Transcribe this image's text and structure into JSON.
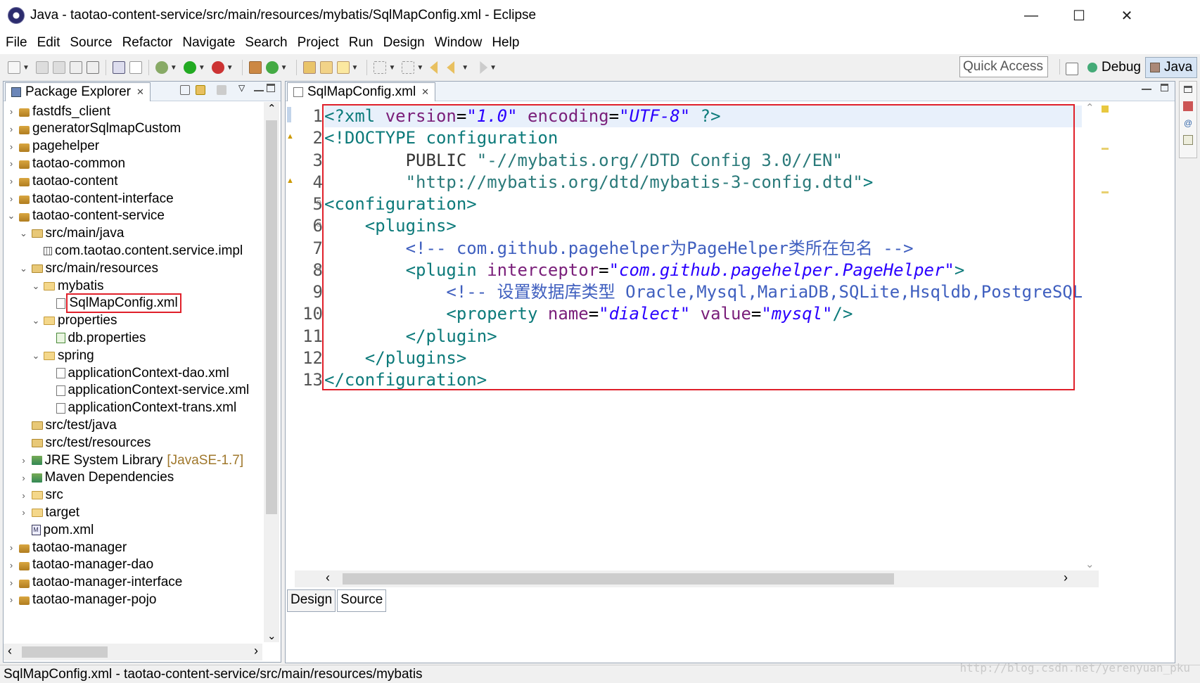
{
  "window": {
    "title": "Java - taotao-content-service/src/main/resources/mybatis/SqlMapConfig.xml - Eclipse",
    "minimize": "—",
    "maximize": "☐",
    "close": "✕"
  },
  "menu": [
    "File",
    "Edit",
    "Source",
    "Refactor",
    "Navigate",
    "Search",
    "Project",
    "Run",
    "Design",
    "Window",
    "Help"
  ],
  "toolbar": {
    "quick_access": "Quick Access",
    "perspective_debug": "Debug",
    "perspective_java": "Java"
  },
  "package_explorer": {
    "title": "Package Explorer",
    "items": [
      {
        "label": "fastdfs_client",
        "arrow": "›",
        "icon": "project-icon"
      },
      {
        "label": "generatorSqlmapCustom",
        "arrow": "›",
        "icon": "project-icon"
      },
      {
        "label": "pagehelper",
        "arrow": "›",
        "icon": "project-icon"
      },
      {
        "label": "taotao-common",
        "arrow": "›",
        "icon": "project-icon"
      },
      {
        "label": "taotao-content",
        "arrow": "›",
        "icon": "project-icon"
      },
      {
        "label": "taotao-content-interface",
        "arrow": "›",
        "icon": "project-icon"
      },
      {
        "label": "taotao-content-service",
        "arrow": "⌄",
        "icon": "project-icon"
      },
      {
        "label": "src/main/java",
        "arrow": "⌄",
        "icon": "source-folder-icon"
      },
      {
        "label": "com.taotao.content.service.impl",
        "arrow": "",
        "icon": "package-icon"
      },
      {
        "label": "src/main/resources",
        "arrow": "⌄",
        "icon": "source-folder-icon"
      },
      {
        "label": "mybatis",
        "arrow": "⌄",
        "icon": "folder-icon"
      },
      {
        "label": "SqlMapConfig.xml",
        "arrow": "",
        "icon": "xml-file-icon"
      },
      {
        "label": "properties",
        "arrow": "⌄",
        "icon": "folder-icon"
      },
      {
        "label": "db.properties",
        "arrow": "",
        "icon": "properties-file-icon"
      },
      {
        "label": "spring",
        "arrow": "⌄",
        "icon": "folder-icon"
      },
      {
        "label": "applicationContext-dao.xml",
        "arrow": "",
        "icon": "xml-file-icon"
      },
      {
        "label": "applicationContext-service.xml",
        "arrow": "",
        "icon": "xml-file-icon"
      },
      {
        "label": "applicationContext-trans.xml",
        "arrow": "",
        "icon": "xml-file-icon"
      },
      {
        "label": "src/test/java",
        "arrow": "",
        "icon": "source-folder-icon"
      },
      {
        "label": "src/test/resources",
        "arrow": "",
        "icon": "source-folder-icon"
      },
      {
        "label": "JRE System Library",
        "suffix": "[JavaSE-1.7]",
        "arrow": "›",
        "icon": "library-icon"
      },
      {
        "label": "Maven Dependencies",
        "arrow": "›",
        "icon": "library-icon"
      },
      {
        "label": "src",
        "arrow": "›",
        "icon": "folder-icon"
      },
      {
        "label": "target",
        "arrow": "›",
        "icon": "folder-icon"
      },
      {
        "label": "pom.xml",
        "arrow": "",
        "icon": "maven-file-icon"
      },
      {
        "label": "taotao-manager",
        "arrow": "›",
        "icon": "project-icon"
      },
      {
        "label": "taotao-manager-dao",
        "arrow": "›",
        "icon": "project-icon"
      },
      {
        "label": "taotao-manager-interface",
        "arrow": "›",
        "icon": "project-icon"
      },
      {
        "label": "taotao-manager-pojo",
        "arrow": "›",
        "icon": "project-icon"
      }
    ]
  },
  "editor": {
    "tab_title": "SqlMapConfig.xml",
    "line_numbers": [
      "1",
      "2",
      "3",
      "4",
      "5",
      "6",
      "7",
      "8",
      "9",
      "10",
      "11",
      "12",
      "13"
    ],
    "lines": [
      [
        {
          "t": "<?xml ",
          "c": "pi"
        },
        {
          "t": "version",
          "c": "attr"
        },
        {
          "t": "=",
          "c": "plain"
        },
        {
          "t": "\"1.0\"",
          "c": "str"
        },
        {
          "t": " ",
          "c": "plain"
        },
        {
          "t": "encoding",
          "c": "attr"
        },
        {
          "t": "=",
          "c": "plain"
        },
        {
          "t": "\"UTF-8\"",
          "c": "str"
        },
        {
          "t": " ?>",
          "c": "pi"
        }
      ],
      [
        {
          "t": "<!DOCTYPE configuration",
          "c": "kw"
        }
      ],
      [
        {
          "t": "        PUBLIC ",
          "c": "doc"
        },
        {
          "t": "\"-//mybatis.org//DTD Config 3.0//EN\"",
          "c": "dstr"
        }
      ],
      [
        {
          "t": "        ",
          "c": "doc"
        },
        {
          "t": "\"http://mybatis.org/dtd/mybatis-3-config.dtd\"",
          "c": "dstr"
        },
        {
          "t": ">",
          "c": "kw"
        }
      ],
      [
        {
          "t": "<configuration>",
          "c": "tag"
        }
      ],
      [
        {
          "t": "    <plugins>",
          "c": "tag"
        }
      ],
      [
        {
          "t": "        <!-- com.github.pagehelper为PageHelper类所在包名 -->",
          "c": "comment"
        }
      ],
      [
        {
          "t": "        <plugin ",
          "c": "tag"
        },
        {
          "t": "interceptor",
          "c": "attr"
        },
        {
          "t": "=",
          "c": "plain"
        },
        {
          "t": "\"com.github.pagehelper.PageHelper\"",
          "c": "str"
        },
        {
          "t": ">",
          "c": "tag"
        }
      ],
      [
        {
          "t": "            <!-- 设置数据库类型 Oracle,Mysql,MariaDB,SQLite,Hsqldb,PostgreSQL六种数据库-->",
          "c": "comment"
        }
      ],
      [
        {
          "t": "            <property ",
          "c": "tag"
        },
        {
          "t": "name",
          "c": "attr"
        },
        {
          "t": "=",
          "c": "plain"
        },
        {
          "t": "\"dialect\"",
          "c": "str"
        },
        {
          "t": " ",
          "c": "plain"
        },
        {
          "t": "value",
          "c": "attr"
        },
        {
          "t": "=",
          "c": "plain"
        },
        {
          "t": "\"mysql\"",
          "c": "str"
        },
        {
          "t": "/>",
          "c": "tag"
        }
      ],
      [
        {
          "t": "        </plugin>",
          "c": "tag"
        }
      ],
      [
        {
          "t": "    </plugins>",
          "c": "tag"
        }
      ],
      [
        {
          "t": "</configuration>",
          "c": "tag"
        }
      ]
    ],
    "bottom_tabs": [
      "Design",
      "Source"
    ],
    "active_bottom_tab": "Source"
  },
  "status": {
    "text": "SqlMapConfig.xml - taotao-content-service/src/main/resources/mybatis",
    "watermark": "http://blog.csdn.net/yerenyuan_pku"
  },
  "colors": {
    "highlight_box": "#e0202a",
    "selection_border": "#9aa6b5"
  }
}
